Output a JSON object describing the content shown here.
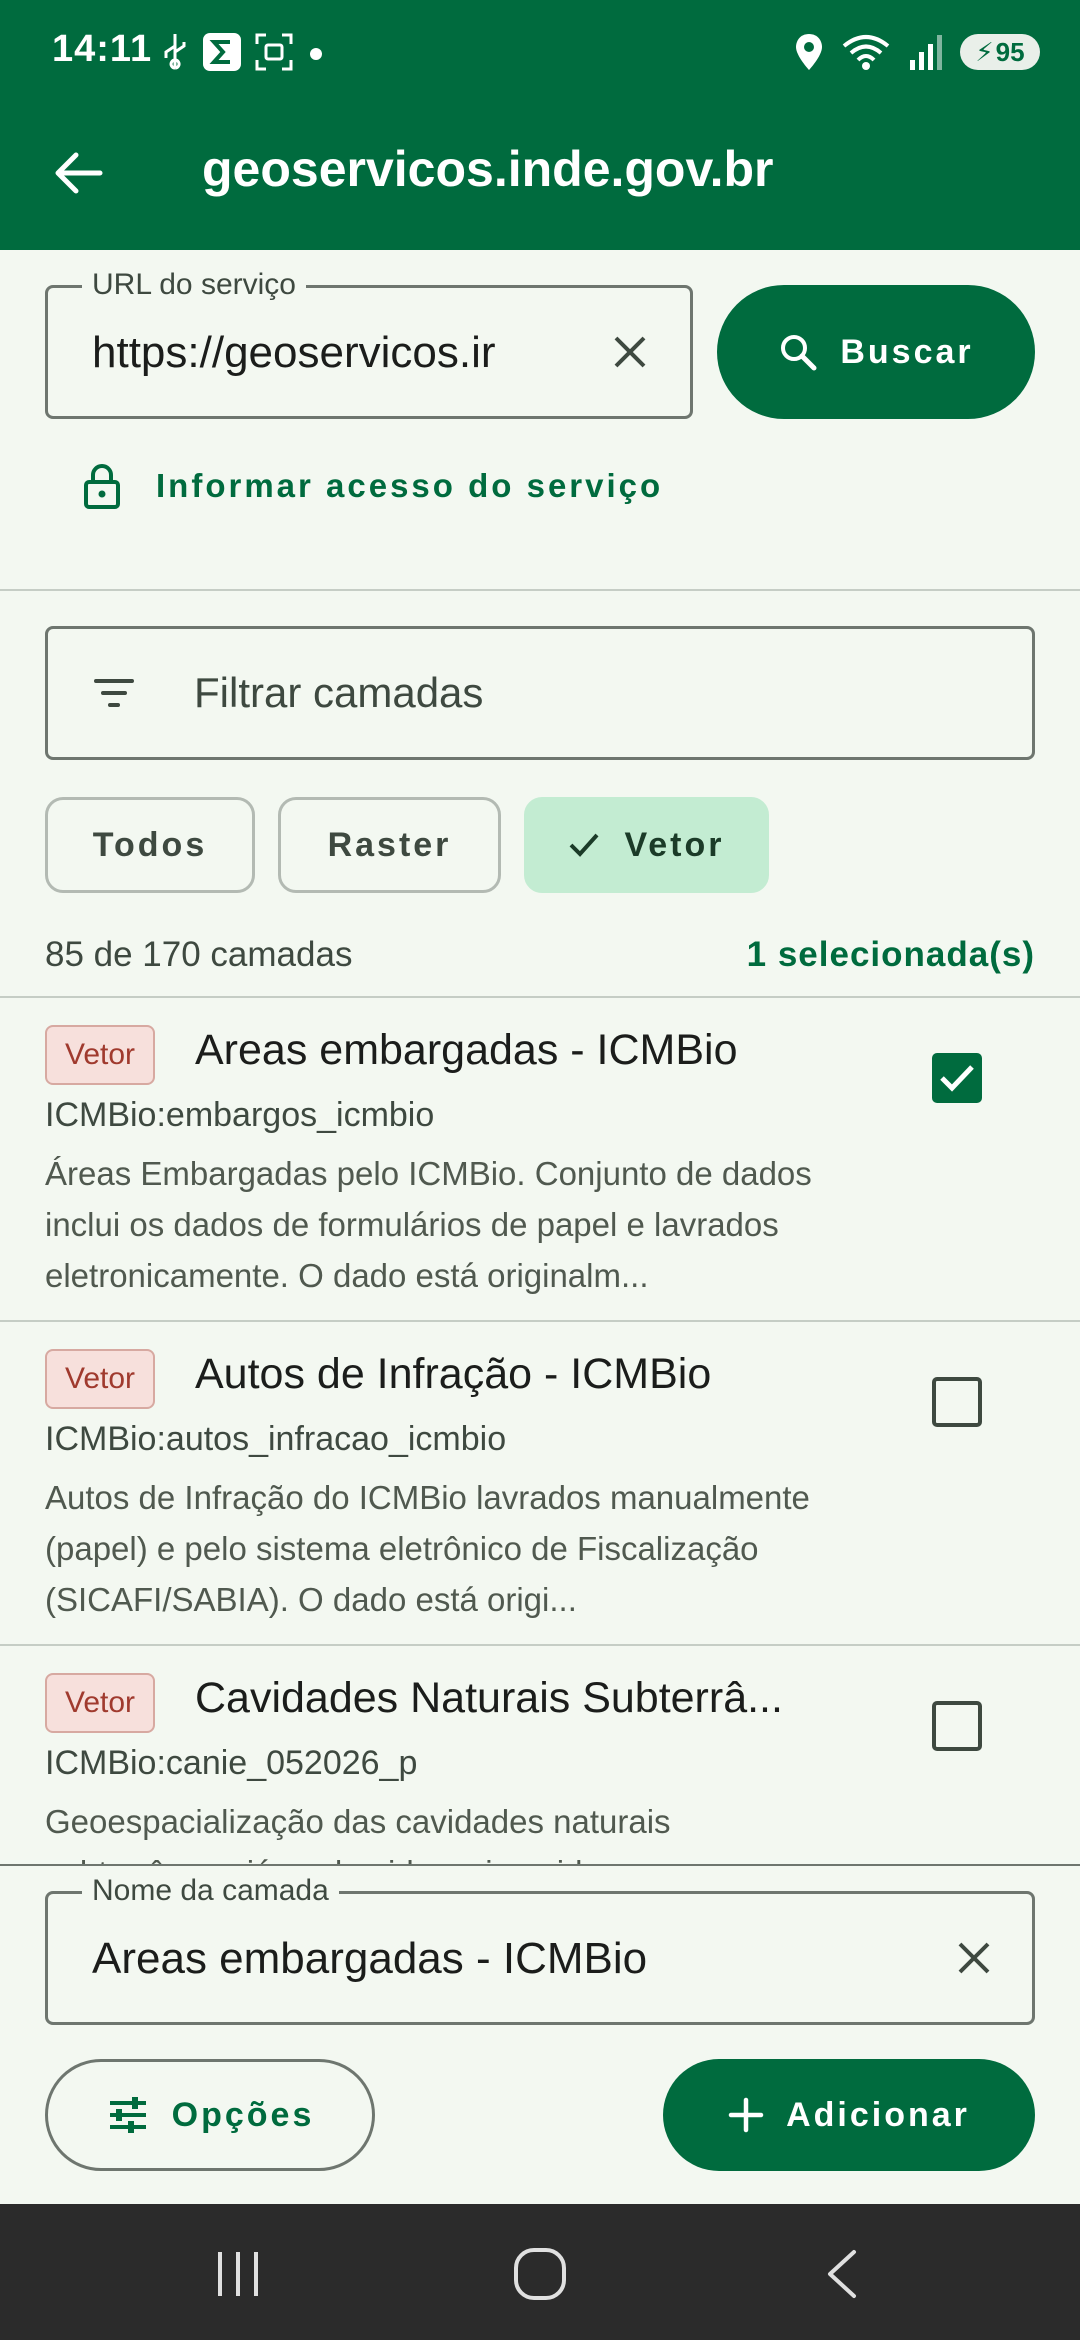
{
  "status_bar": {
    "time": "14:11",
    "battery": "95",
    "left_icons": [
      "usb-icon",
      "sigma-app-icon",
      "screenshot-icon",
      "dot-icon"
    ],
    "right_icons": [
      "location-icon",
      "wifi-icon",
      "signal-icon",
      "battery-icon"
    ]
  },
  "app_bar": {
    "title": "geoservicos.inde.gov.br"
  },
  "url_field": {
    "label": "URL do serviço",
    "value": "https://geoservicos.ir"
  },
  "search_button": {
    "label": "Buscar"
  },
  "access_link": {
    "label": "Informar acesso do serviço"
  },
  "filter": {
    "placeholder": "Filtrar camadas"
  },
  "chips": [
    {
      "label": "Todos",
      "selected": false
    },
    {
      "label": "Raster",
      "selected": false
    },
    {
      "label": "Vetor",
      "selected": true
    }
  ],
  "counts": {
    "summary": "85 de 170 camadas",
    "selected": "1 selecionada(s)"
  },
  "layers": [
    {
      "badge": "Vetor",
      "title": "Areas embargadas - ICMBio",
      "id": "ICMBio:embargos_icmbio",
      "description": "Áreas Embargadas pelo ICMBio. Conjunto de dados inclui os dados de formulários de papel e lavrados eletronicamente. O dado está originalm...",
      "checked": true
    },
    {
      "badge": "Vetor",
      "title": "Autos de Infração - ICMBio",
      "id": "ICMBio:autos_infracao_icmbio",
      "description": "Autos de Infração do ICMBio lavrados manualmente (papel) e pelo sistema eletrônico de Fiscalização (SICAFI/SABIA). O dado está origi...",
      "checked": false
    },
    {
      "badge": "Vetor",
      "title": "Cavidades Naturais Subterrâ...",
      "id": "ICMBio:canie_052026_p",
      "description": "Geoespacialização das cavidades naturais subterrâneas já conhecidas e inseridas no",
      "checked": false
    }
  ],
  "layer_name_field": {
    "label": "Nome da camada",
    "value": "Areas embargadas - ICMBio"
  },
  "options_button": {
    "label": "Opções"
  },
  "add_button": {
    "label": "Adicionar"
  },
  "colors": {
    "primary": "#006b3e",
    "chip_selected": "#c3ecd2",
    "badge_bg": "#f7e0dc",
    "badge_text": "#a03a2e",
    "background": "#f3f8f1",
    "nav_bar": "#2b2b2b"
  }
}
